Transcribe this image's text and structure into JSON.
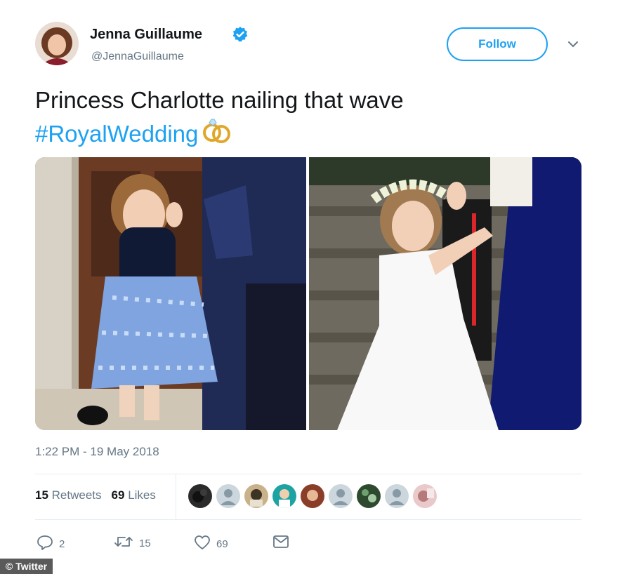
{
  "user": {
    "name": "Jenna Guillaume",
    "handle": "@JennaGuillaume",
    "verified_icon": "verified-badge-icon"
  },
  "follow_label": "Follow",
  "tweet": {
    "text": "Princess Charlotte nailing that wave",
    "hashtag": "#RoyalWedding",
    "emoji": "rings-emoji"
  },
  "timestamp": "1:22 PM - 19 May 2018",
  "stats": {
    "retweets_count": "15",
    "retweets_label": "Retweets",
    "likes_count": "69",
    "likes_label": "Likes"
  },
  "actions": {
    "reply_count": "2",
    "retweet_count": "15",
    "like_count": "69"
  },
  "credit": "© Twitter",
  "colors": {
    "accent": "#1da1f2",
    "muted": "#657786"
  }
}
